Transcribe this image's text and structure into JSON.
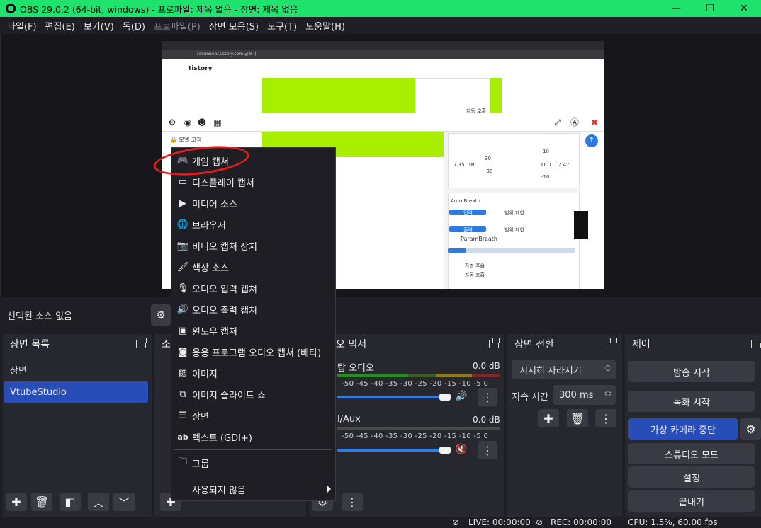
{
  "window": {
    "title": "OBS 29.0.2 (64-bit, windows) - 프로파일: 제목 없음 - 장면: 제목 없음",
    "min": "—",
    "max": "☐",
    "close": "✕"
  },
  "menu": [
    "파일(F)",
    "편집(E)",
    "보기(V)",
    "독(D)",
    "프로파일(P)",
    "장면 모음(S)",
    "도구(T)",
    "도움말(H)"
  ],
  "preview": {
    "address": "rakunbear.tistory.com 글쓰기",
    "site": "tistory",
    "lock_label": "모델 고정",
    "auto_breath": "Auto Breath",
    "in_label": "IN",
    "out_label": "OUT",
    "in_val": "7.35",
    "out_val": "2.47",
    "param_breath": "ParamBreath",
    "range_limit": "범위 제한",
    "input_label": "입력",
    "output_label": "출력",
    "auto_label": "자동 호흡",
    "v30": "30",
    "v_30": "-30",
    "v10": "10",
    "v_10": "-10"
  },
  "source_bar": {
    "no_source": "선택된 소스 없음",
    "gear": "⚙"
  },
  "scenes": {
    "header": "장면 목록",
    "items": [
      {
        "label": "장면",
        "selected": false
      },
      {
        "label": "VtubeStudio",
        "selected": true
      }
    ]
  },
  "sources": {
    "header": "소"
  },
  "mixer": {
    "header": "오 믹서",
    "tracks": [
      {
        "name": "탑 오디오",
        "db": "0.0 dB"
      },
      {
        "name": "l/Aux",
        "db": "0.0 dB"
      }
    ],
    "ticks": "-50  -45  -40  -35  -30  -25  -20  -15  -10   -5    0"
  },
  "transitions": {
    "header": "장면 전환",
    "selected": "서서히 사라지기",
    "duration_label": "지속 시간",
    "duration_value": "300 ms"
  },
  "controls": {
    "header": "제어",
    "buttons": [
      "방송 시작",
      "녹화 시작",
      "가상 카메라 중단",
      "스튜디오 모드",
      "설정",
      "끝내기"
    ]
  },
  "status": {
    "live": "LIVE: 00:00:00",
    "rec": "REC: 00:00:00",
    "cpu": "CPU: 1.5%, 60.00 fps"
  },
  "context_menu": {
    "items": [
      {
        "label": "게임 캡쳐",
        "icon": "gamepad-icon"
      },
      {
        "label": "디스플레이 캡쳐",
        "icon": "monitor-icon"
      },
      {
        "label": "미디어 소스",
        "icon": "play-icon"
      },
      {
        "label": "브라우저",
        "icon": "globe-icon"
      },
      {
        "label": "비디오 캡쳐 장치",
        "icon": "camera-icon"
      },
      {
        "label": "색상 소스",
        "icon": "brush-icon"
      },
      {
        "label": "오디오 입력 캡쳐",
        "icon": "microphone-icon"
      },
      {
        "label": "오디오 출력 캡쳐",
        "icon": "speaker-icon"
      },
      {
        "label": "윈도우 캡쳐",
        "icon": "window-icon"
      },
      {
        "label": "응용 프로그램 오디오 캡쳐 (베타)",
        "icon": "app-audio-icon"
      },
      {
        "label": "이미지",
        "icon": "image-icon"
      },
      {
        "label": "이미지 슬라이드 쇼",
        "icon": "slideshow-icon"
      },
      {
        "label": "장면",
        "icon": "list-icon"
      },
      {
        "label": "텍스트 (GDI+)",
        "icon": "text-icon"
      },
      {
        "label": "그룹",
        "icon": "folder-icon"
      },
      {
        "label": "사용되지 않음",
        "icon": ""
      }
    ]
  },
  "colors": {
    "titlebar": "#20e36e",
    "accent": "#284cb8",
    "annotation": "#e01c1c"
  }
}
